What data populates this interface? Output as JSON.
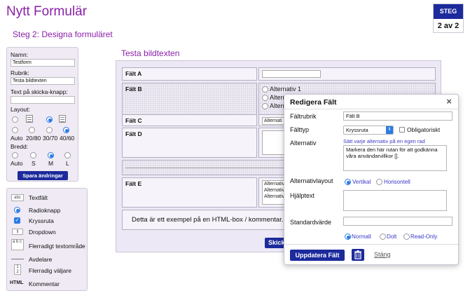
{
  "header": {
    "app_title": "Nytt Formulär",
    "step_title": "Steg 2: Designa formuläret",
    "step_badge_label": "STEG",
    "step_badge_value": "2 av 2"
  },
  "settings": {
    "name_label": "Namn:",
    "name_value": "Testform",
    "heading_label": "Rubrik:",
    "heading_value": "Testa bildtexten",
    "submit_text_label": "Text på skicka-knapp:",
    "submit_text_value": "",
    "layout_label": "Layout:",
    "layout_options": [
      "Auto",
      "20/80",
      "30/70",
      "40/60"
    ],
    "width_label": "Bredd:",
    "width_options": [
      "Auto",
      "S",
      "M",
      "L"
    ],
    "save_button": "Spara ändringar"
  },
  "toolbox": {
    "items": [
      {
        "icon": "abc",
        "label": "Textfält"
      },
      {
        "icon": "radio-icon",
        "label": "Radioknapp"
      },
      {
        "icon": "checkbox-icon",
        "label": "Kryssruta"
      },
      {
        "icon": "dropdown-icon",
        "label": "Dropdown"
      },
      {
        "icon": "a b c",
        "label": "Flerradigt textområde"
      },
      {
        "icon": "divider-icon",
        "label": "Avdelare"
      },
      {
        "icon": "1 2",
        "label": "Flerradig väljare"
      },
      {
        "icon": "HTML",
        "label": "Kommentar"
      }
    ]
  },
  "form_preview": {
    "title": "Testa bildtexten",
    "fields": {
      "a": "Fält A",
      "b": "Fält B",
      "b_option_1": "Alternativ 1",
      "b_option_2": "Altern",
      "b_option_3": "Altern",
      "c": "Fält C",
      "c_select": "Alternati",
      "d": "Fält D",
      "e": "Fält E",
      "e_list": [
        "Alternativ",
        "Alternativ",
        "Alternativ"
      ]
    },
    "html_text": "Detta är ett exempel på en HTML-box / kommentar.",
    "submit_partial": "Skick"
  },
  "dialog": {
    "title": "Redigera Fält",
    "close_glyph": "×",
    "field_title_label": "Fältrubrik",
    "field_title_value": "Fält B",
    "field_type_label": "Fälttyp",
    "field_type_value": "Kryssruta",
    "required_label": "Obligatoriskt",
    "options_label": "Alternativ",
    "options_hint": "Sätt varje alternativ på en egen rad",
    "options_value": "Markera den här rutan för att godkänna våra användarvillkor [].",
    "options_layout_label": "Alternativlayout",
    "layout_vertical": "Vertikal",
    "layout_horizontal": "Horisontell",
    "help_label": "Hjälptext",
    "help_value": "",
    "default_label": "Standardvärde",
    "default_value": "",
    "visibility_normal": "Normalt",
    "visibility_hidden": "Dolt",
    "visibility_readonly": "Read-Only",
    "update_button": "Uppdatera Fält",
    "close_link": "Stäng"
  }
}
